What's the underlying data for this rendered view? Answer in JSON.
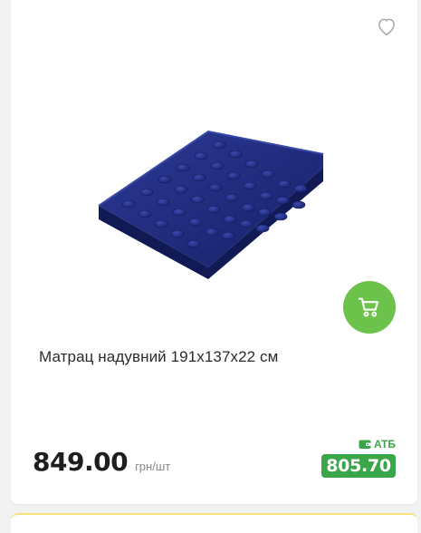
{
  "product": {
    "name": "Матрац надувний 191x137x22 см",
    "price": "849.00",
    "unit": "грн/шт",
    "promo_label": "АТБ",
    "promo_price": "805.70"
  },
  "icons": {
    "favorite": "heart-icon",
    "cart": "cart-icon",
    "promo": "wallet-icon"
  },
  "colors": {
    "cart_button": "#6cc24a",
    "promo_green": "#3aa64a",
    "mattress": "#1f2a78"
  }
}
